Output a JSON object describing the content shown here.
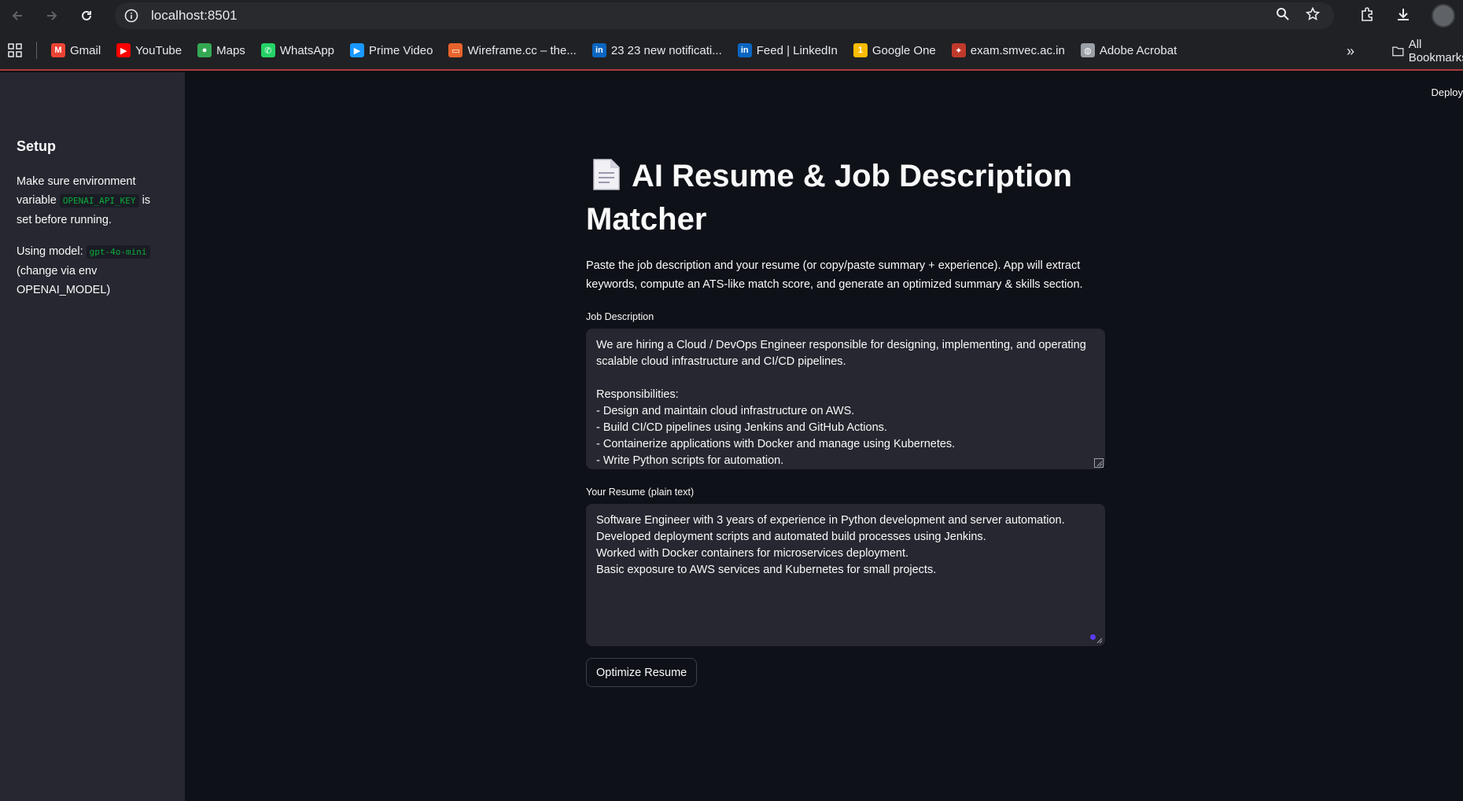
{
  "browser": {
    "url": "localhost:8501",
    "bookmarks": [
      {
        "label": "Gmail",
        "icon": "gmail-icon",
        "color": "#ea4335"
      },
      {
        "label": "YouTube",
        "icon": "youtube-icon",
        "color": "#ff0000"
      },
      {
        "label": "Maps",
        "icon": "maps-icon",
        "color": "#34a853"
      },
      {
        "label": "WhatsApp",
        "icon": "whatsapp-icon",
        "color": "#25d366"
      },
      {
        "label": "Prime Video",
        "icon": "prime-video-icon",
        "color": "#1a98ff"
      },
      {
        "label": "Wireframe.cc – the...",
        "icon": "wireframe-icon",
        "color": "#e8632b"
      },
      {
        "label": "23 23 new notificati...",
        "icon": "linkedin-icon",
        "color": "#0a66c2"
      },
      {
        "label": "Feed | LinkedIn",
        "icon": "linkedin-icon",
        "color": "#0a66c2"
      },
      {
        "label": "Google One",
        "icon": "google-one-icon",
        "color": "#fbbc04"
      },
      {
        "label": "exam.smvec.ac.in",
        "icon": "smvec-icon",
        "color": "#c0392b"
      },
      {
        "label": "Adobe Acrobat",
        "icon": "globe-icon",
        "color": "#9aa0a6"
      }
    ],
    "all_bookmarks_label": "All Bookmarks"
  },
  "sidebar": {
    "heading": "Setup",
    "env_text_before": "Make sure environment variable",
    "env_code": "OPENAI_API_KEY",
    "env_text_after": "is set before running.",
    "model_text_before": "Using model:",
    "model_code": "gpt-4o-mini",
    "model_text_after": "(change via env OPENAI_MODEL)"
  },
  "header": {
    "deploy_label": "Deploy"
  },
  "main": {
    "title": "AI Resume & Job Description Matcher",
    "intro": "Paste the job description and your resume (or copy/paste summary + experience). App will extract keywords, compute an ATS-like match score, and generate an optimized summary & skills section.",
    "jd_label": "Job Description",
    "jd_value": "We are hiring a Cloud / DevOps Engineer responsible for designing, implementing, and operating scalable cloud infrastructure and CI/CD pipelines.\n\nResponsibilities:\n- Design and maintain cloud infrastructure on AWS.\n- Build CI/CD pipelines using Jenkins and GitHub Actions.\n- Containerize applications with Docker and manage using Kubernetes.\n- Write Python scripts for automation.",
    "resume_label": "Your Resume (plain text)",
    "resume_value": "Software Engineer with 3 years of experience in Python development and server automation.\nDeveloped deployment scripts and automated build processes using Jenkins.\nWorked with Docker containers for microservices deployment.\nBasic exposure to AWS services and Kubernetes for small projects.",
    "button_label": "Optimize Resume"
  },
  "colors": {
    "app_bg": "#0e1117",
    "sidebar_bg": "#262730",
    "input_bg": "#262730",
    "code_green": "#09ab3b",
    "accent": "#5b3cf0"
  }
}
